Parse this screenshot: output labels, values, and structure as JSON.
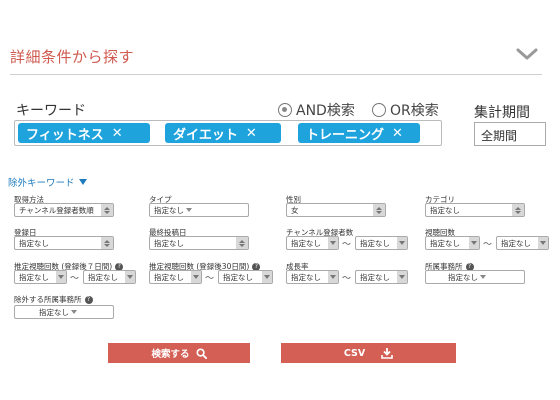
{
  "header": {
    "title": "詳細条件から探す"
  },
  "keyword": {
    "label": "キーワード",
    "radio_and": "AND検索",
    "radio_or": "OR検索",
    "tags": [
      "フィットネス",
      "ダイエット",
      "トレーニング"
    ],
    "remove_glyph": "✕"
  },
  "period": {
    "label": "集計期間",
    "value": "全期間"
  },
  "exclude_keyword": {
    "label": "除外キーワード"
  },
  "filters": {
    "sort": {
      "label": "取得方法",
      "value": "チャンネル登録者数順"
    },
    "type": {
      "label": "タイプ",
      "value": "指定なし"
    },
    "gender": {
      "label": "性別",
      "value": "女"
    },
    "category": {
      "label": "カテゴリ",
      "value": "指定なし"
    },
    "registered": {
      "label": "登録日",
      "value": "指定なし"
    },
    "last_post": {
      "label": "最終投稿日",
      "value": "指定なし"
    },
    "subscribers": {
      "label": "チャンネル登録者数",
      "from": "指定なし",
      "to": "指定なし"
    },
    "views": {
      "label": "視聴回数",
      "from": "指定なし",
      "to": "指定なし"
    },
    "est_views_7": {
      "label": "推定視聴回数 (登録後７日間)",
      "from": "指定なし",
      "to": "指定なし"
    },
    "est_views_30": {
      "label": "推定視聴回数 (登録後30日間)",
      "from": "指定なし",
      "to": "指定なし"
    },
    "growth": {
      "label": "成長率",
      "from": "指定なし",
      "to": "指定なし"
    },
    "agency": {
      "label": "所属事務所",
      "value": "指定なし"
    },
    "exclude_agency": {
      "label": "除外する所属事務所",
      "value": "指定なし"
    },
    "range_sep": "〜"
  },
  "buttons": {
    "search": "検索する",
    "csv": "CSV"
  },
  "colors": {
    "accent": "#d35f55",
    "title": "#cf5a4f",
    "tag": "#1ea3dd",
    "link": "#1e7bbd"
  }
}
